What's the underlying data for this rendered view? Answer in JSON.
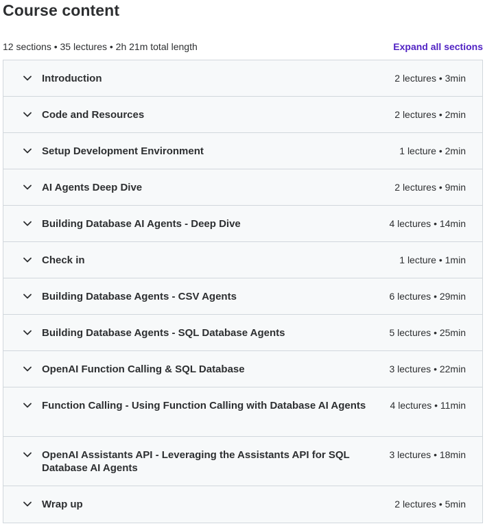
{
  "header": {
    "title": "Course content",
    "summary": "12 sections • 35 lectures • 2h 21m total length",
    "expand_all_label": "Expand all sections"
  },
  "sections": [
    {
      "title": "Introduction",
      "meta": "2 lectures • 3min"
    },
    {
      "title": "Code and Resources",
      "meta": "2 lectures • 2min"
    },
    {
      "title": "Setup Development Environment",
      "meta": "1 lecture • 2min"
    },
    {
      "title": "AI Agents Deep Dive",
      "meta": "2 lectures • 9min"
    },
    {
      "title": "Building Database AI Agents - Deep Dive",
      "meta": "4 lectures • 14min"
    },
    {
      "title": "Check in",
      "meta": "1 lecture • 1min"
    },
    {
      "title": "Building Database Agents - CSV Agents",
      "meta": "6 lectures • 29min"
    },
    {
      "title": "Building Database Agents - SQL Database Agents",
      "meta": "5 lectures • 25min"
    },
    {
      "title": "OpenAI Function Calling & SQL Database",
      "meta": "3 lectures • 22min"
    },
    {
      "title": "Function Calling - Using Function Calling with Database AI Agents",
      "meta": "4 lectures • 11min"
    },
    {
      "title": "OpenAI Assistants API - Leveraging the Assistants API for SQL Database AI Agents",
      "meta": "3 lectures • 18min"
    },
    {
      "title": "Wrap up",
      "meta": "2 lectures • 5min"
    }
  ],
  "icons": {
    "section_toggle": "chevron-down-icon"
  },
  "colors": {
    "accent": "#5022c3",
    "row_bg": "#f7f9fa",
    "border": "#d1d7dc",
    "text": "#2d2f31"
  }
}
